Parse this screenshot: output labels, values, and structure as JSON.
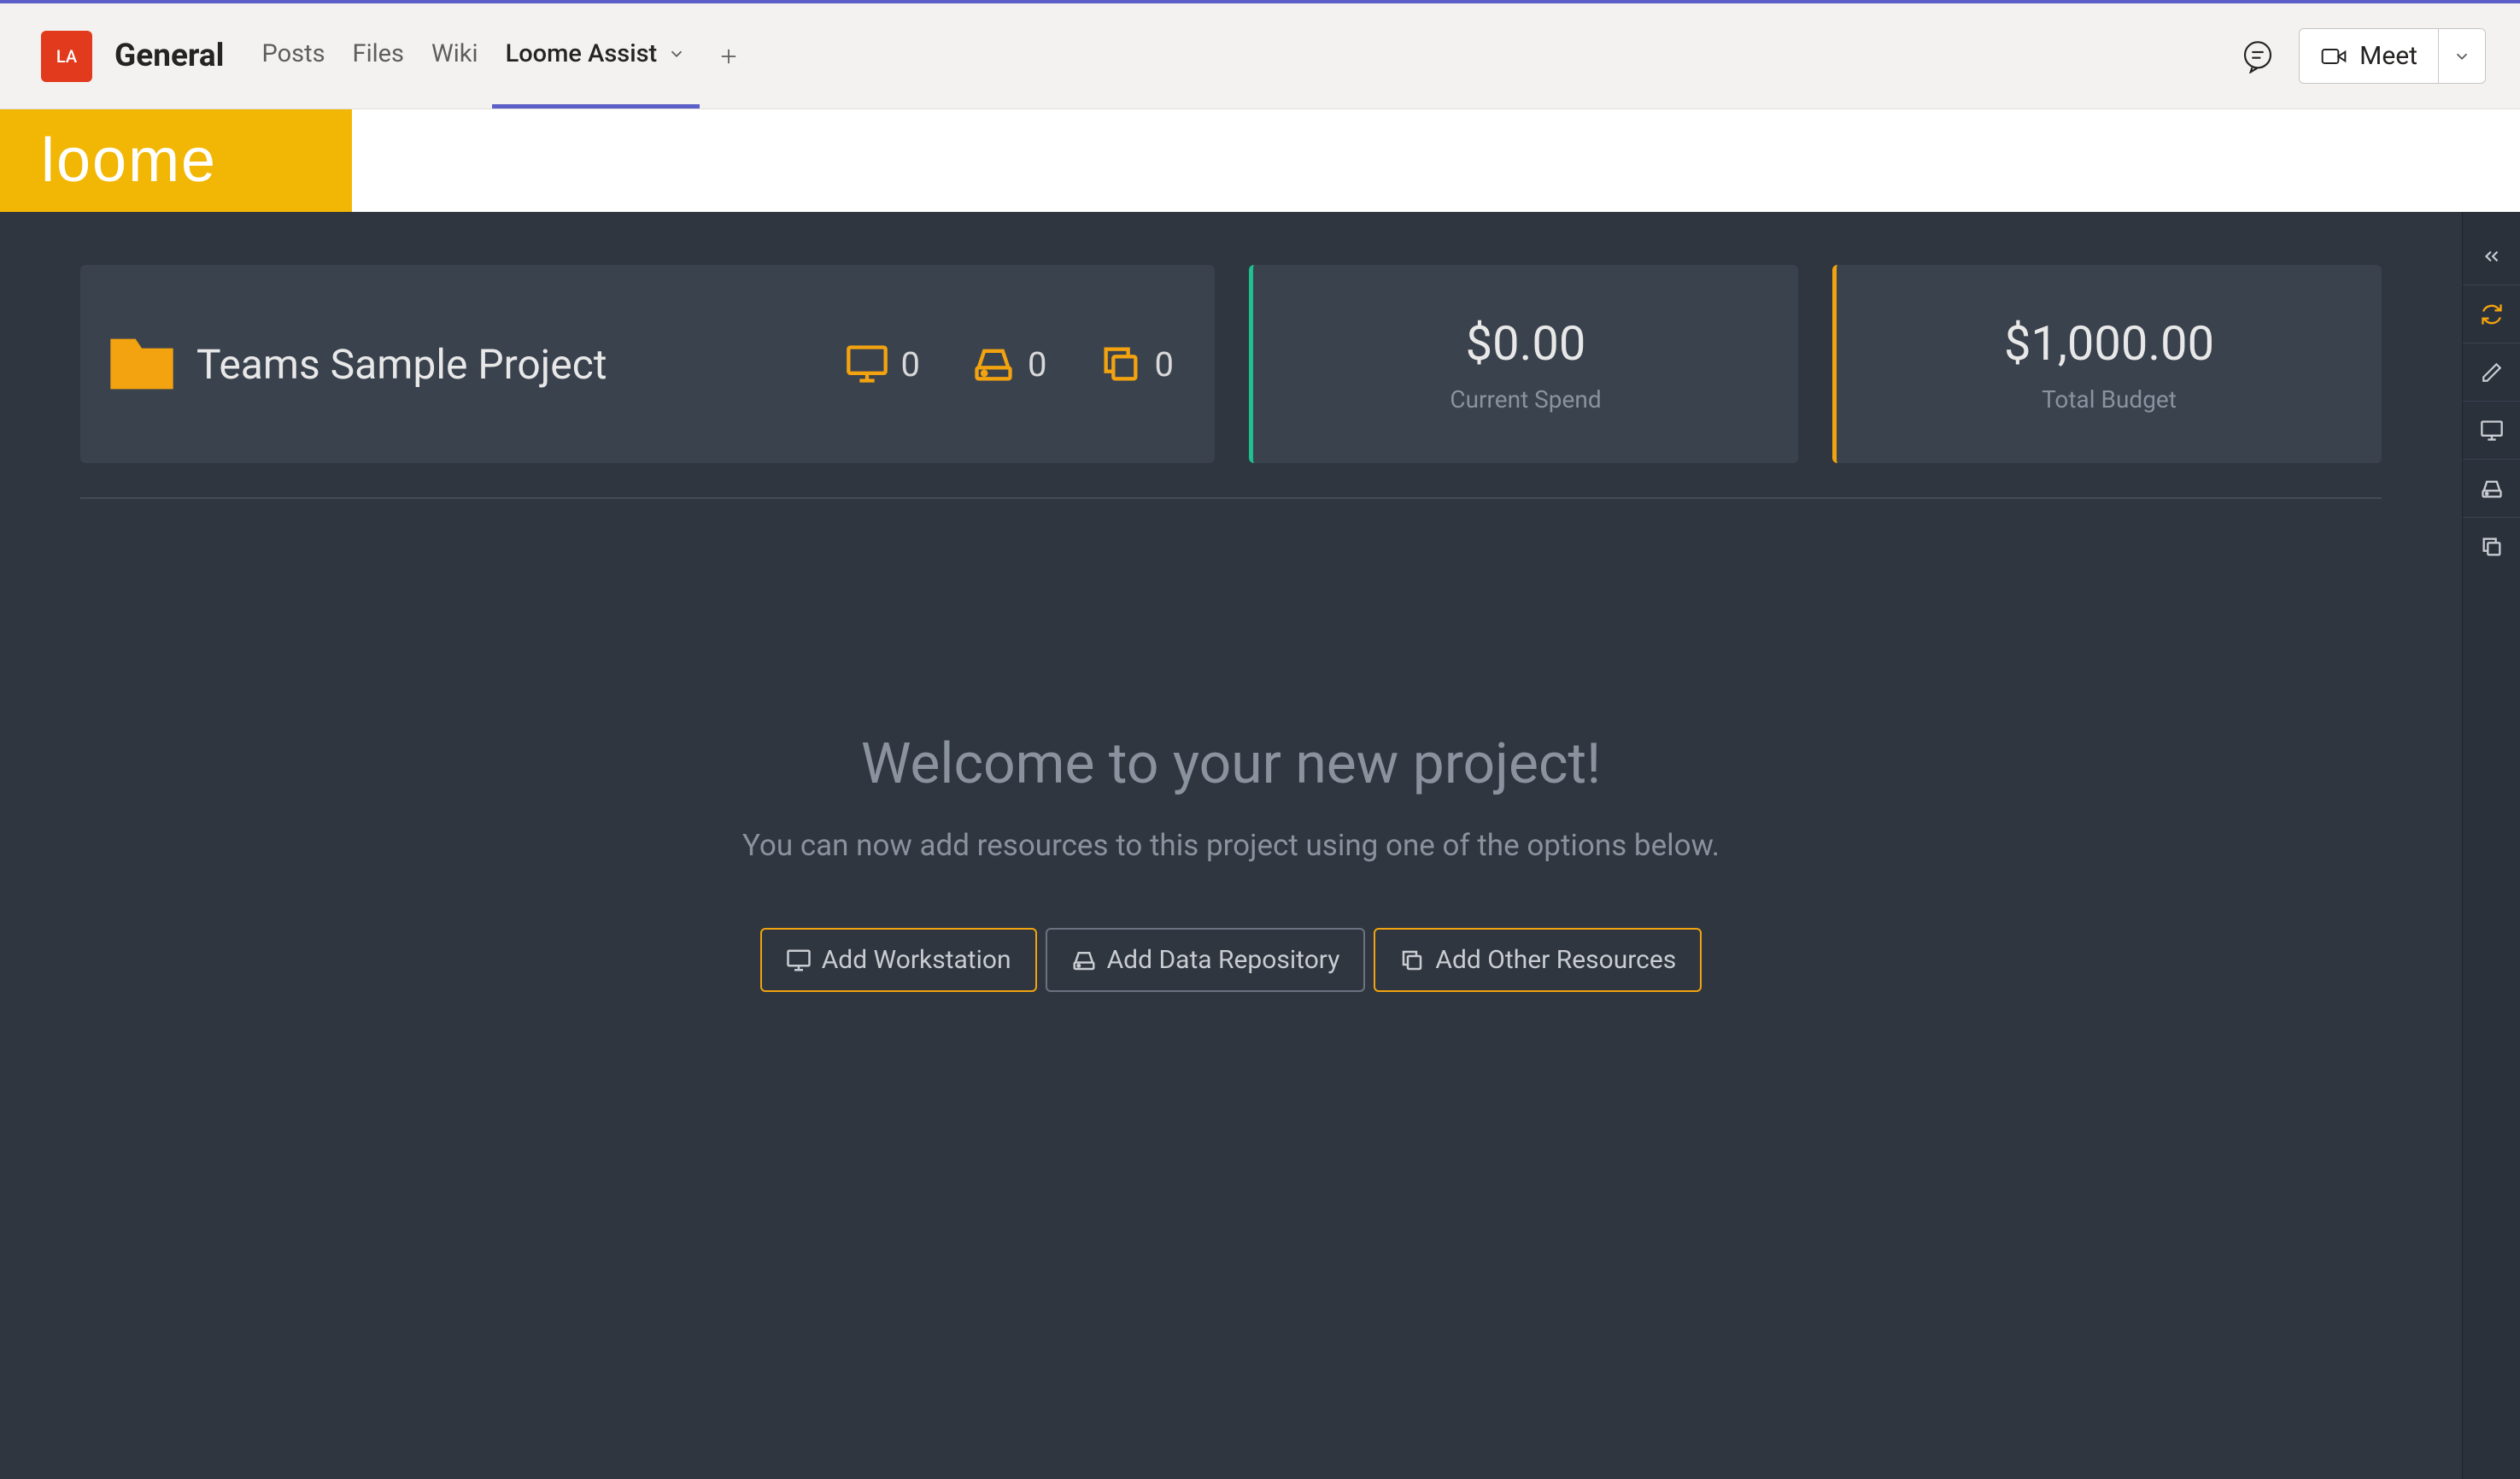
{
  "teams_header": {
    "avatar_initials": "LA",
    "channel_title": "General",
    "tabs": [
      {
        "label": "Posts",
        "active": false
      },
      {
        "label": "Files",
        "active": false
      },
      {
        "label": "Wiki",
        "active": false
      },
      {
        "label": "Loome Assist",
        "active": true
      }
    ],
    "meet_label": "Meet"
  },
  "loome_brand": "loome",
  "project": {
    "name": "Teams Sample Project",
    "workstation_count": "0",
    "repository_count": "0",
    "other_resources_count": "0"
  },
  "spend": {
    "value": "$0.00",
    "label": "Current Spend"
  },
  "budget": {
    "value": "$1,000.00",
    "label": "Total Budget"
  },
  "welcome": {
    "title": "Welcome to your new project!",
    "subtitle": "You can now add resources to this project using one of the options below."
  },
  "actions": {
    "add_workstation": "Add Workstation",
    "add_repository": "Add Data Repository",
    "add_other": "Add Other Resources"
  }
}
